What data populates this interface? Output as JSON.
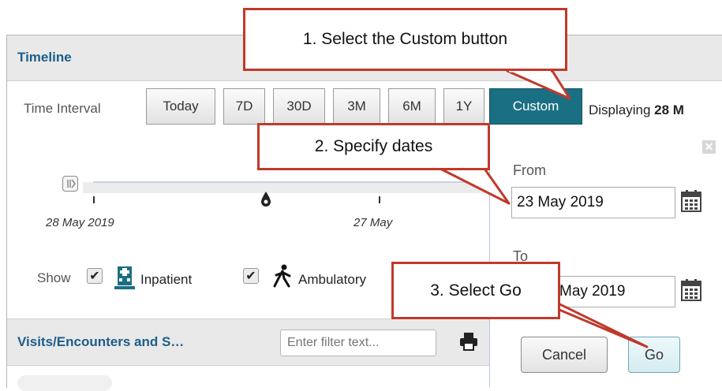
{
  "timeline": {
    "title": "Timeline",
    "time_interval_label": "Time Interval",
    "interval_buttons": [
      "Today",
      "7D",
      "30D",
      "3M",
      "6M",
      "1Y",
      "Custom"
    ],
    "active_interval": "Custom",
    "displaying_prefix": "Displaying",
    "displaying_value": "28 M",
    "slider": {
      "start_date": "28 May 2019",
      "end_date": "27 May"
    },
    "show_label": "Show",
    "filters": [
      {
        "label": "Inpatient",
        "checked": true,
        "icon": "hospital-icon"
      },
      {
        "label": "Ambulatory",
        "checked": true,
        "icon": "walking-person-icon"
      }
    ]
  },
  "visits": {
    "title": "Visits/Encounters and S…",
    "filter_placeholder": "Enter filter text...",
    "print_icon": "printer-icon"
  },
  "custom_popup": {
    "from_label": "From",
    "from_value": "23 May 2019",
    "to_label": "To",
    "to_value": "May 2019",
    "cancel_label": "Cancel",
    "go_label": "Go",
    "close_icon": "close-icon",
    "calendar_icon": "calendar-icon"
  },
  "callouts": [
    {
      "text": "1. Select the Custom button"
    },
    {
      "text": "2. Specify dates"
    },
    {
      "text": "3.  Select Go"
    }
  ],
  "colors": {
    "accent": "#1b6f83",
    "title_blue": "#1c5d8a",
    "callout_border": "#c0392b"
  }
}
